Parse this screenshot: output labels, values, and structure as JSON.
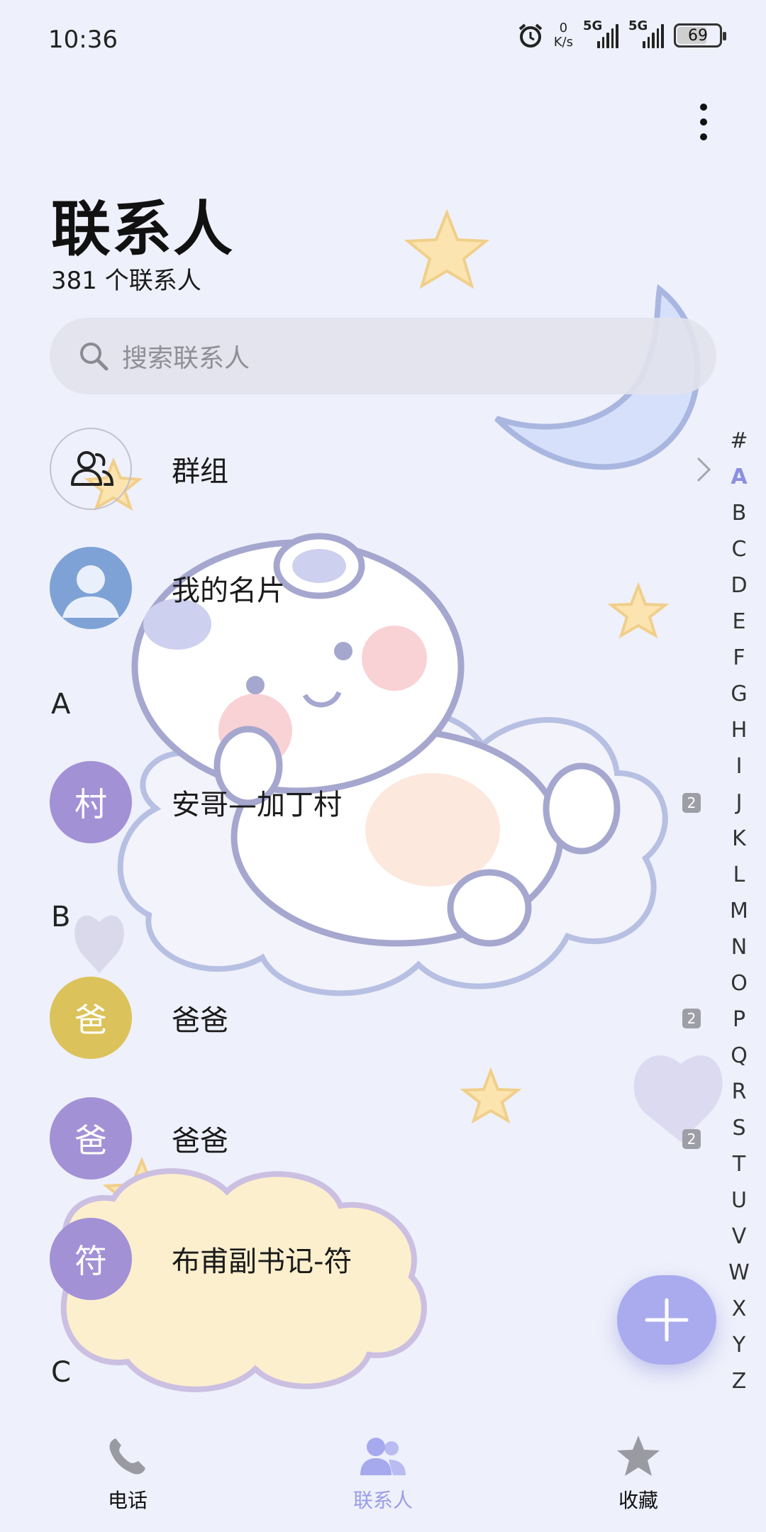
{
  "status_bar": {
    "time": "10:36",
    "net_speed_value": "0",
    "net_speed_unit": "K/s",
    "sim1": "5G",
    "sim2": "5G",
    "battery": "69"
  },
  "header": {
    "title": "联系人",
    "count": "381 个联系人"
  },
  "search": {
    "placeholder": "搜索联系人"
  },
  "rows": {
    "groups": "群组",
    "my_card": "我的名片"
  },
  "sections": [
    {
      "letter": "A",
      "contacts": [
        {
          "avatar_char": "村",
          "name": "安哥—加丁村",
          "badge": "2",
          "color": "#a391d6"
        }
      ]
    },
    {
      "letter": "B",
      "contacts": [
        {
          "avatar_char": "爸",
          "name": "爸爸",
          "badge": "2",
          "color": "#dcc25a"
        },
        {
          "avatar_char": "爸",
          "name": "爸爸",
          "badge": "2",
          "color": "#a391d6"
        },
        {
          "avatar_char": "符",
          "name": "布甫副书记-符",
          "badge": "",
          "color": "#a391d6"
        }
      ]
    },
    {
      "letter": "C",
      "contacts": []
    }
  ],
  "alphabet_index": [
    "#",
    "A",
    "B",
    "C",
    "D",
    "E",
    "F",
    "G",
    "H",
    "I",
    "J",
    "K",
    "L",
    "M",
    "N",
    "O",
    "P",
    "Q",
    "R",
    "S",
    "T",
    "U",
    "V",
    "W",
    "X",
    "Y",
    "Z"
  ],
  "alphabet_active": "A",
  "tabs": [
    {
      "label": "电话",
      "icon": "phone-icon",
      "active": false
    },
    {
      "label": "联系人",
      "icon": "contacts-icon",
      "active": true
    },
    {
      "label": "收藏",
      "icon": "star-icon",
      "active": false
    }
  ],
  "colors": {
    "accent": "#9b9de6",
    "background": "#eef0fb",
    "my_card_avatar": "#7fa2d6"
  }
}
